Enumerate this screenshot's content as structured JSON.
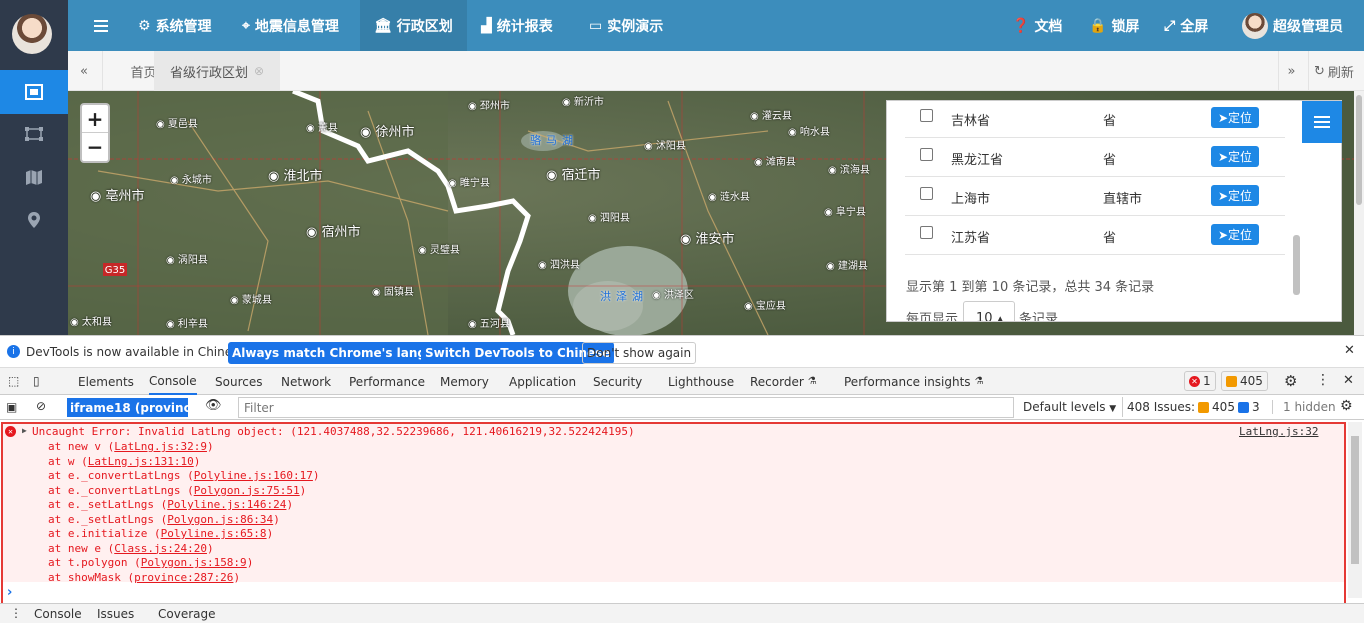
{
  "sidebar": {
    "items": [
      {
        "icon": "region-icon",
        "active": true
      },
      {
        "icon": "polygon-icon"
      },
      {
        "icon": "map-icon"
      },
      {
        "icon": "location-pin-icon"
      }
    ]
  },
  "topbar": {
    "menu_icon": "hamburger-icon",
    "nav": [
      {
        "label": "系统管理",
        "icon": "gear-icon"
      },
      {
        "label": "地震信息管理",
        "icon": "map-marker-icon"
      },
      {
        "label": "行政区划",
        "icon": "bank-icon",
        "active": true
      },
      {
        "label": "统计报表",
        "icon": "chart-icon"
      },
      {
        "label": "实例演示",
        "icon": "monitor-icon"
      }
    ],
    "right": [
      {
        "label": "文档",
        "icon": "question-icon"
      },
      {
        "label": "锁屏",
        "icon": "lock-icon"
      },
      {
        "label": "全屏",
        "icon": "expand-icon"
      }
    ],
    "user": "超级管理员"
  },
  "tabs": {
    "home": "首页",
    "current": "省级行政区划",
    "refresh": "刷新"
  },
  "map": {
    "zoom_in": "+",
    "zoom_out": "−",
    "cities": [
      "徐州市",
      "淮北市",
      "宿迁市",
      "宿州市",
      "淮安市",
      "亳州市"
    ],
    "lakes": [
      "骆马湖",
      "洪泽湖"
    ],
    "counties": [
      "夏邑县",
      "永城市",
      "萧县",
      "睢宁县",
      "泗阳县",
      "沭阳县",
      "灌云县",
      "涟水县",
      "阜宁县",
      "灵璧县",
      "泗洪县",
      "洪泽区",
      "蒙城县",
      "固镇县",
      "涡阳县",
      "利辛县",
      "五河县",
      "滨海县",
      "响水县",
      "滩南县",
      "邳州市",
      "新沂市",
      "太和县",
      "建湖县",
      "宝应县"
    ],
    "road": "G35"
  },
  "panel": {
    "rows": [
      {
        "name": "吉林省",
        "type": "省",
        "button": "定位"
      },
      {
        "name": "黑龙江省",
        "type": "省",
        "button": "定位"
      },
      {
        "name": "上海市",
        "type": "直辖市",
        "button": "定位"
      },
      {
        "name": "江苏省",
        "type": "省",
        "button": "定位"
      }
    ],
    "summary": "显示第 1 到第 10 条记录，总共 34 条记录",
    "per_page_prefix": "每页显示",
    "per_page_value": "10",
    "per_page_suffix": "条记录"
  },
  "infobar": {
    "message": "DevTools is now available in Chinese!",
    "btn_match": "Always match Chrome's language",
    "btn_switch": "Switch DevTools to Chinese",
    "btn_dont": "Don't show again"
  },
  "devtools": {
    "tabs": [
      "Elements",
      "Console",
      "Sources",
      "Network",
      "Performance",
      "Memory",
      "Application",
      "Security",
      "Lighthouse",
      "Recorder",
      "Performance insights"
    ],
    "active_tab": "Console",
    "error_count": "1",
    "warning_count": "405",
    "context": "iframe18 (province)",
    "filter_placeholder": "Filter",
    "levels": "Default levels",
    "issues_label": "408 Issues:",
    "issues_warn": "405",
    "issues_info": "3",
    "hidden": "1 hidden"
  },
  "console": {
    "error": "Uncaught Error: Invalid LatLng object: (121.4037488,32.52239686, 121.40616219,32.522424195)",
    "source": "LatLng.js:32",
    "stack": [
      {
        "fn": "at new v (",
        "loc": "LatLng.js:32:9",
        "end": ")"
      },
      {
        "fn": "at w (",
        "loc": "LatLng.js:131:10",
        "end": ")"
      },
      {
        "fn": "at e._convertLatLngs (",
        "loc": "Polyline.js:160:17",
        "end": ")"
      },
      {
        "fn": "at e._convertLatLngs (",
        "loc": "Polygon.js:75:51",
        "end": ")"
      },
      {
        "fn": "at e._setLatLngs (",
        "loc": "Polyline.js:146:24",
        "end": ")"
      },
      {
        "fn": "at e._setLatLngs (",
        "loc": "Polygon.js:86:34",
        "end": ")"
      },
      {
        "fn": "at e.initialize (",
        "loc": "Polyline.js:65:8",
        "end": ")"
      },
      {
        "fn": "at new e (",
        "loc": "Class.js:24:20",
        "end": ")"
      },
      {
        "fn": "at t.polygon (",
        "loc": "Polygon.js:158:9",
        "end": ")"
      },
      {
        "fn": "at showMask (",
        "loc": "province:287:26",
        "end": ")"
      }
    ],
    "prompt": "›"
  },
  "drawer": {
    "tabs": [
      "Console",
      "Issues",
      "Coverage"
    ]
  },
  "colors": {
    "topbar": "#3c8dbc",
    "sidebar": "#2f3a4b",
    "accent": "#1e88e5",
    "error": "#e5181f",
    "highlight": "#e53935"
  }
}
